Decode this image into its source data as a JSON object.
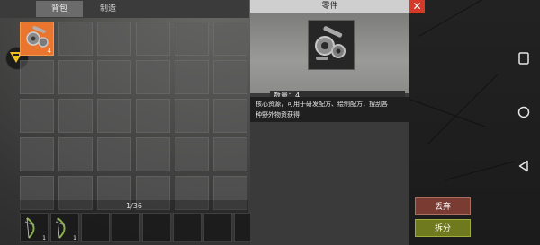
{
  "tabs": [
    {
      "label": "背包",
      "active": true
    },
    {
      "label": "制造",
      "active": false
    }
  ],
  "inventory": {
    "selected_item": {
      "name": "零件",
      "icon": "gear-parts-icon",
      "count": "4"
    },
    "page_count": "1/36",
    "highlight_color": "#e9752e"
  },
  "hotbar": [
    {
      "icon": "bow-icon",
      "count": "1"
    },
    {
      "icon": "bow-icon",
      "count": "1"
    }
  ],
  "detail": {
    "title": "零件",
    "quantity": "数量：4",
    "description_line1": "核心资源，可用于研发配方、绘制配方，搜刮各",
    "description_line2": "种野外物资获得"
  },
  "actions": {
    "discard_label": "丢弃",
    "discard_color": "#7a3b33",
    "split_label": "拆分",
    "split_color": "#6f7a1e",
    "close_symbol": "✕"
  },
  "system_nav": {
    "square": "recent-apps-icon",
    "circle": "home-icon",
    "triangle": "back-icon"
  }
}
